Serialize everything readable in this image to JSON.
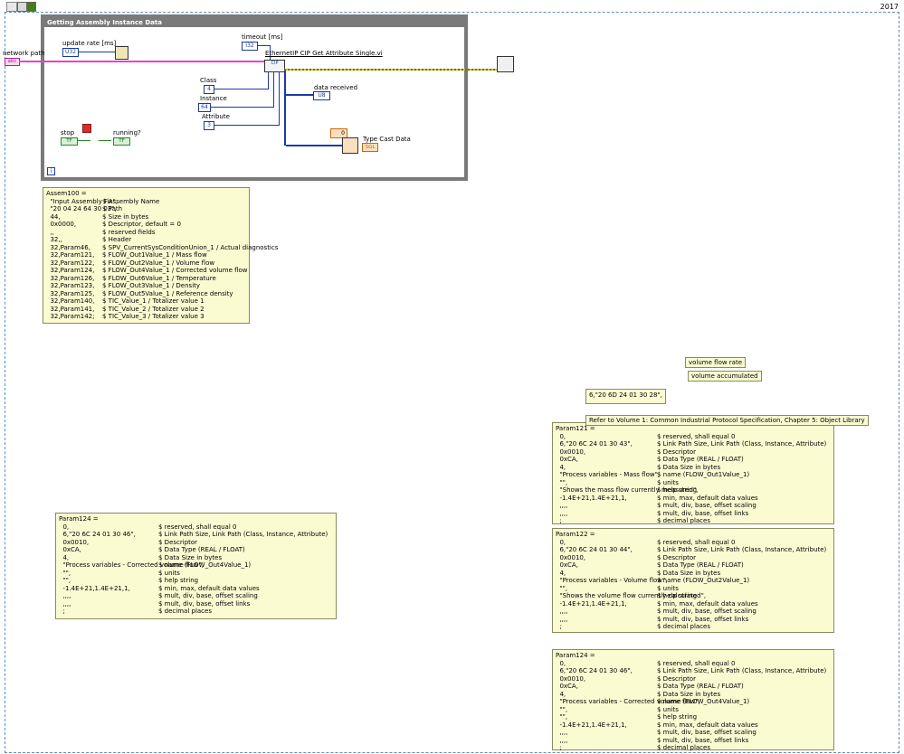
{
  "header": {
    "year": "2017"
  },
  "loop": {
    "title": "Getting Assembly Instance Data",
    "iteration": "i"
  },
  "controls": {
    "network_path": "network path",
    "update_rate": "update rate [ms]",
    "update_rate_type": "U32",
    "timeout": "timeout [ms]",
    "timeout_type": "I32",
    "class_label": "Class",
    "class_value": "4",
    "instance_label": "Instance",
    "instance_value": "64",
    "attribute_label": "Attribute",
    "attribute_value": "3",
    "stop": "stop",
    "running": "running?",
    "data_received": "data received",
    "type_cast": "Type Cast Data",
    "type_cast_const": "0",
    "vi_name": "EthernetIP CIP Get Attribute Single.vi",
    "bool_type": "TF",
    "path_type": "abc",
    "u8_type": "U8",
    "sgl_type": "SGL"
  },
  "notes": {
    "assem": [
      [
        "Assem100 =",
        ""
      ],
      [
        "  \"Input Assembly Fix\",",
        "$ Assembly Name"
      ],
      [
        "  \"20 04 24 64 30 03\",",
        "$ Path"
      ],
      [
        "  44,",
        "$ Size in bytes"
      ],
      [
        "  0x0000,",
        "$ Descriptor, default = 0"
      ],
      [
        "  ,,",
        "$ reserved fields"
      ],
      [
        "  32,,",
        "$ Header"
      ],
      [
        "  32,Param46,",
        "$ SPV_CurrentSysConditionUnion_1 / Actual diagnostics"
      ],
      [
        "  32,Param121,",
        "$ FLOW_Out1Value_1 / Mass flow"
      ],
      [
        "  32,Param122,",
        "$ FLOW_Out2Value_1 / Volume flow"
      ],
      [
        "  32,Param124,",
        "$ FLOW_Out4Value_1 / Corrected volume flow"
      ],
      [
        "  32,Param126,",
        "$ FLOW_Out6Value_1 / Temperature"
      ],
      [
        "  32,Param123,",
        "$ FLOW_Out3Value_1 / Density"
      ],
      [
        "  32,Param125,",
        "$ FLOW_Out5Value_1 / Reference density"
      ],
      [
        "  32,Param140,",
        "$ TIC_Value_1 / Totalizer value 1"
      ],
      [
        "  32,Param141,",
        "$ TIC_Value_2 / Totalizer value 2"
      ],
      [
        "  32,Param142;",
        "$ TIC_Value_3 / Totalizer value 3"
      ]
    ],
    "param124_left": [
      [
        "Param124 =",
        ""
      ],
      [
        "  0,",
        "$ reserved, shall equal 0"
      ],
      [
        "  6,\"20 6C 24 01 30 46\",",
        "$ Link Path Size, Link Path (Class, Instance, Attribute)"
      ],
      [
        "  0x0010,",
        "$ Descriptor"
      ],
      [
        "  0xCA,",
        "$ Data Type (REAL / FLOAT)"
      ],
      [
        "  4,",
        "$ Data Size in bytes"
      ],
      [
        "  \"Process variables - Corrected volume flow\",",
        "$ name (FLOW_Out4Value_1)"
      ],
      [
        "  \"\",",
        "$ units"
      ],
      [
        "  \"\",",
        "$ help string"
      ],
      [
        "  -1.4E+21,1.4E+21,1,",
        "$ min, max, default data values"
      ],
      [
        "  ,,,,",
        "$ mult, div, base, offset scaling"
      ],
      [
        "  ,,,,",
        "$ mult, div, base, offset links"
      ],
      [
        "  ;",
        "$ decimal places"
      ]
    ],
    "param121": [
      [
        "Param121 =",
        ""
      ],
      [
        "  0,",
        "$ reserved, shall equal 0"
      ],
      [
        "  6,\"20 6C 24 01 30 43\",",
        "$ Link Path Size, Link Path (Class, Instance, Attribute)"
      ],
      [
        "  0x0010,",
        "$ Descriptor"
      ],
      [
        "  0xCA,",
        "$ Data Type (REAL / FLOAT)"
      ],
      [
        "  4,",
        "$ Data Size in bytes"
      ],
      [
        "  \"Process variables - Mass flow\",",
        "$ name (FLOW_Out1Value_1)"
      ],
      [
        "  \"\",",
        "$ units"
      ],
      [
        "  \"Shows the mass flow currently measured\",",
        "$ help string"
      ],
      [
        "  -1.4E+21,1.4E+21,1,",
        "$ min, max, default data values"
      ],
      [
        "  ,,,,",
        "$ mult, div, base, offset scaling"
      ],
      [
        "  ,,,,",
        "$ mult, div, base, offset links"
      ],
      [
        "  ;",
        "$ decimal places"
      ]
    ],
    "param122": [
      [
        "Param122 =",
        ""
      ],
      [
        "  0,",
        "$ reserved, shall equal 0"
      ],
      [
        "  6,\"20 6C 24 01 30 44\",",
        "$ Link Path Size, Link Path (Class, Instance, Attribute)"
      ],
      [
        "  0x0010,",
        "$ Descriptor"
      ],
      [
        "  0xCA,",
        "$ Data Type (REAL / FLOAT)"
      ],
      [
        "  4,",
        "$ Data Size in bytes"
      ],
      [
        "  \"Process variables - Volume flow\",",
        "$ name (FLOW_Out2Value_1)"
      ],
      [
        "  \"\",",
        "$ units"
      ],
      [
        "  \"Shows the volume flow currently calculated\",",
        "$ help string"
      ],
      [
        "  -1.4E+21,1.4E+21,1,",
        "$ min, max, default data values"
      ],
      [
        "  ,,,,",
        "$ mult, div, base, offset scaling"
      ],
      [
        "  ,,,,",
        "$ mult, div, base, offset links"
      ],
      [
        "  ;",
        "$ decimal places"
      ]
    ],
    "param124_right": [
      [
        "Param124 =",
        ""
      ],
      [
        "  0,",
        "$ reserved, shall equal 0"
      ],
      [
        "  6,\"20 6C 24 01 30 46\",",
        "$ Link Path Size, Link Path (Class, Instance, Attribute)"
      ],
      [
        "  0x0010,",
        "$ Descriptor"
      ],
      [
        "  0xCA,",
        "$ Data Type (REAL / FLOAT)"
      ],
      [
        "  4,",
        "$ Data Size in bytes"
      ],
      [
        "  \"Process variables - Corrected volume flow\",",
        "$ name (FLOW_Out4Value_1)"
      ],
      [
        "  \"\",",
        "$ units"
      ],
      [
        "  \"\",",
        "$ help string"
      ],
      [
        "  -1.4E+21,1.4E+21,1,",
        "$ min, max, default data values"
      ],
      [
        "  ,,,,",
        "$ mult, div, base, offset scaling"
      ],
      [
        "  ,,,,",
        "$ mult, div, base, offset links"
      ],
      [
        "  ;",
        "$ decimal places"
      ]
    ],
    "volume_flow_rate": "volume flow rate",
    "volume_accumulated": "volume accumulated",
    "path_string": "6,\"20 6D 24 01 30 28\",",
    "refer": "Refer to Volume 1: Common Industrial Protocol Specification, Chapter 5: Object Library"
  }
}
